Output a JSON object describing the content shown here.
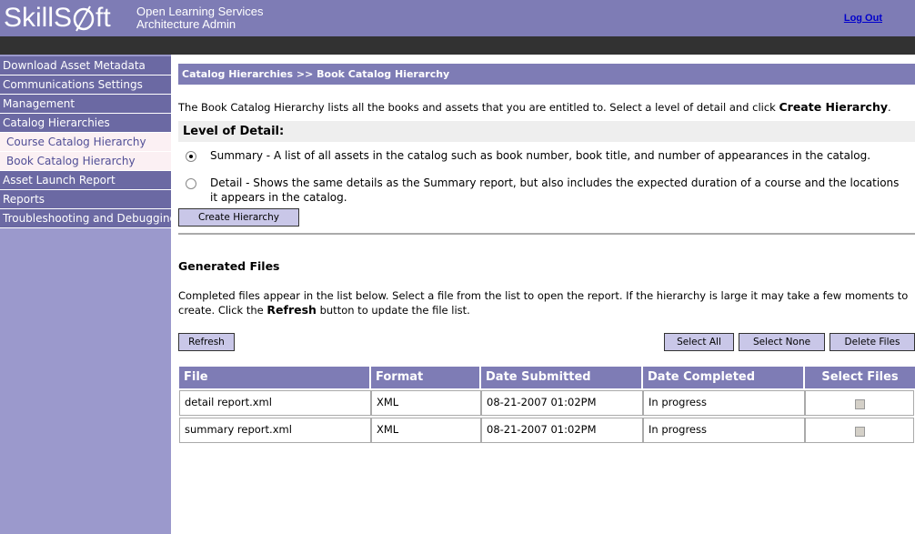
{
  "header": {
    "logo_text": "SkillS",
    "logo_text_tail": "ft",
    "subtitle_line1": "Open Learning Services",
    "subtitle_line2": "Architecture Admin",
    "logout_label": "Log Out"
  },
  "sidebar": {
    "items": [
      {
        "label": "Download Asset Metadata"
      },
      {
        "label": "Communications Settings"
      },
      {
        "label": "Management"
      },
      {
        "label": "Catalog Hierarchies"
      },
      {
        "label": "Course Catalog Hierarchy"
      },
      {
        "label": "Book Catalog Hierarchy"
      },
      {
        "label": "Asset Launch Report"
      },
      {
        "label": "Reports"
      },
      {
        "label": "Troubleshooting and Debugging"
      }
    ]
  },
  "main": {
    "breadcrumb": "Catalog Hierarchies >> Book Catalog Hierarchy",
    "intro_text": "The Book Catalog Hierarchy lists all the books and assets that you are entitled to. Select a level of detail and click ",
    "intro_bold": "Create Hierarchy",
    "intro_end": ".",
    "level_of_detail_label": "Level of Detail:",
    "options": [
      {
        "text": "Summary - A list of all assets in the catalog such as book number, book title, and number of appearances in the catalog.",
        "checked": true
      },
      {
        "text": "Detail - Shows the same details as the Summary report, but also includes the expected duration of a course and the locations it appears in the catalog.",
        "checked": false
      }
    ],
    "create_button": "Create Hierarchy",
    "generated_title": "Generated Files",
    "generated_desc": "Completed files appear in the list below. Select a file from the list to open the report. If the hierarchy is large it may take a few moments to create. Click the ",
    "generated_desc_bold": "Refresh",
    "generated_desc_end": " button to update the file list.",
    "refresh_button": "Refresh",
    "select_all_button": "Select All",
    "select_none_button": "Select None",
    "delete_files_button": "Delete Files",
    "table": {
      "columns": [
        "File",
        "Format",
        "Date Submitted",
        "Date Completed",
        "Select Files"
      ],
      "rows": [
        {
          "file": "detail report.xml",
          "format": "XML",
          "submitted": "08-21-2007 01:02PM",
          "completed": "In progress",
          "selected": false
        },
        {
          "file": "summary report.xml",
          "format": "XML",
          "submitted": "08-21-2007 01:02PM",
          "completed": "In progress",
          "selected": false
        }
      ]
    }
  },
  "colors": {
    "header_purple": "#7e7cb5",
    "nav_dark": "#6b69a3",
    "nav_sidebar_bg": "#9b99cc",
    "nav_sub_bg": "#fbf0f3",
    "dark_bar": "#323232",
    "button_bg": "#c9c7e8"
  }
}
